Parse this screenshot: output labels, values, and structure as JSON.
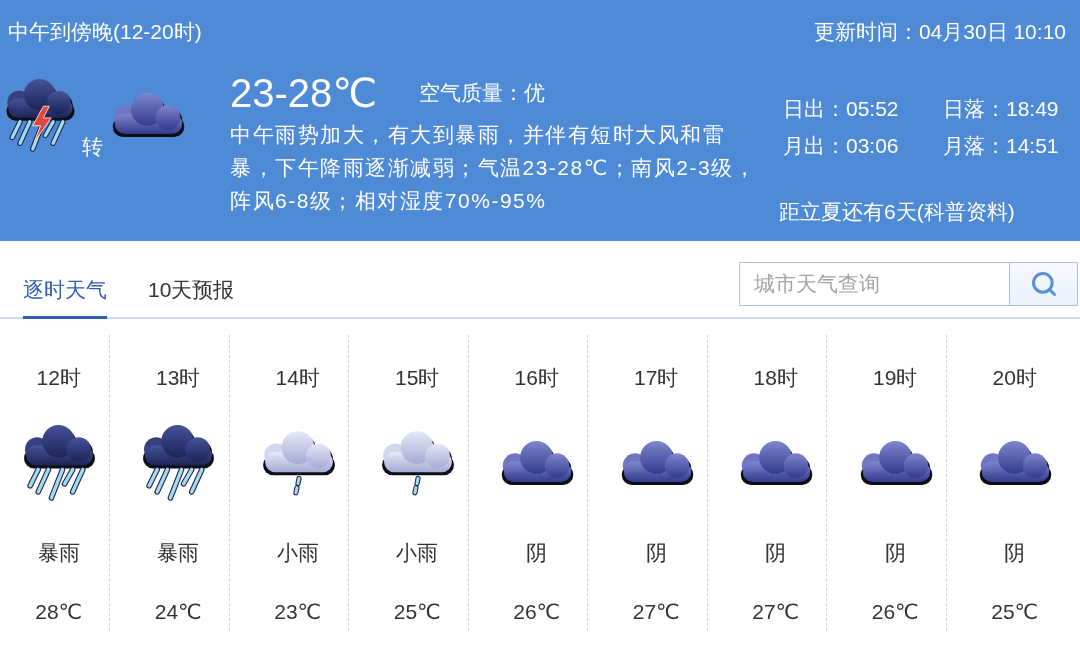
{
  "header": {
    "title": "中午到傍晚(12-20时)",
    "updated": "更新时间：04月30日 10:10",
    "icons": [
      {
        "kind": "thunderstorm"
      },
      {
        "kind": "overcast"
      }
    ],
    "transition": "转",
    "temperature": "23-28℃",
    "air_quality": "空气质量：优",
    "description": "中午雨势加大，有大到暴雨，并伴有短时大风和雷暴，下午降雨逐渐减弱；气温23-28℃；南风2-3级，阵风6-8级；相对湿度70%-95%",
    "astronomy": [
      "日出：05:52",
      "日落：18:49",
      "月出：03:06",
      "月落：14:51"
    ],
    "solar_term": "距立夏还有6天(科普资料)"
  },
  "tabs": [
    {
      "label": "逐时天气",
      "selected": true
    },
    {
      "label": "10天预报",
      "selected": false
    }
  ],
  "search": {
    "placeholder": "城市天气查询"
  },
  "hourly": [
    {
      "hour": "12时",
      "kind": "heavy_rain",
      "condition": "暴雨",
      "temperature": "28℃"
    },
    {
      "hour": "13时",
      "kind": "heavy_rain",
      "condition": "暴雨",
      "temperature": "24℃"
    },
    {
      "hour": "14时",
      "kind": "light_rain",
      "condition": "小雨",
      "temperature": "23℃"
    },
    {
      "hour": "15时",
      "kind": "light_rain",
      "condition": "小雨",
      "temperature": "25℃"
    },
    {
      "hour": "16时",
      "kind": "overcast",
      "condition": "阴",
      "temperature": "26℃"
    },
    {
      "hour": "17时",
      "kind": "overcast",
      "condition": "阴",
      "temperature": "27℃"
    },
    {
      "hour": "18时",
      "kind": "overcast",
      "condition": "阴",
      "temperature": "27℃"
    },
    {
      "hour": "19时",
      "kind": "overcast",
      "condition": "阴",
      "temperature": "26℃"
    },
    {
      "hour": "20时",
      "kind": "overcast",
      "condition": "阴",
      "temperature": "25℃"
    }
  ]
}
